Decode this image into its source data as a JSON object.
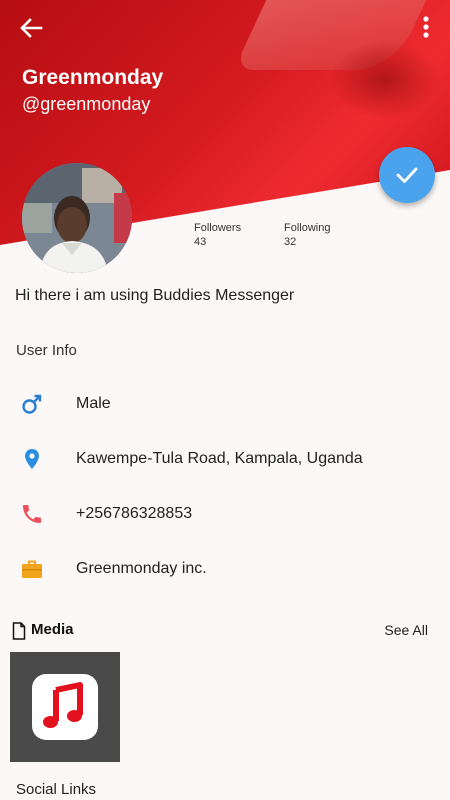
{
  "header": {
    "name": "Greenmonday",
    "username": "@greenmonday"
  },
  "stats": {
    "followers_label": "Followers",
    "followers_value": "43",
    "following_label": "Following",
    "following_value": "32"
  },
  "bio": "Hi there i am using Buddies Messenger",
  "user_info": {
    "title": "User Info",
    "items": [
      {
        "icon": "male-icon",
        "text": "Male",
        "color": "#2a7fd4"
      },
      {
        "icon": "location-pin-icon",
        "text": "Kawempe-Tula Road, Kampala, Uganda",
        "color": "#2a8fe0"
      },
      {
        "icon": "phone-icon",
        "text": "+256786328853",
        "color": "#e8505b"
      },
      {
        "icon": "briefcase-icon",
        "text": "Greenmonday inc.",
        "color": "#f2a51a"
      }
    ]
  },
  "media": {
    "title": "Media",
    "see_all": "See All",
    "items": [
      {
        "icon": "music-note-icon"
      }
    ]
  },
  "social_links": {
    "title": "Social Links"
  },
  "colors": {
    "accent": "#4aa3ec",
    "cover": "#d31a1f",
    "music_red": "#e3101e"
  }
}
